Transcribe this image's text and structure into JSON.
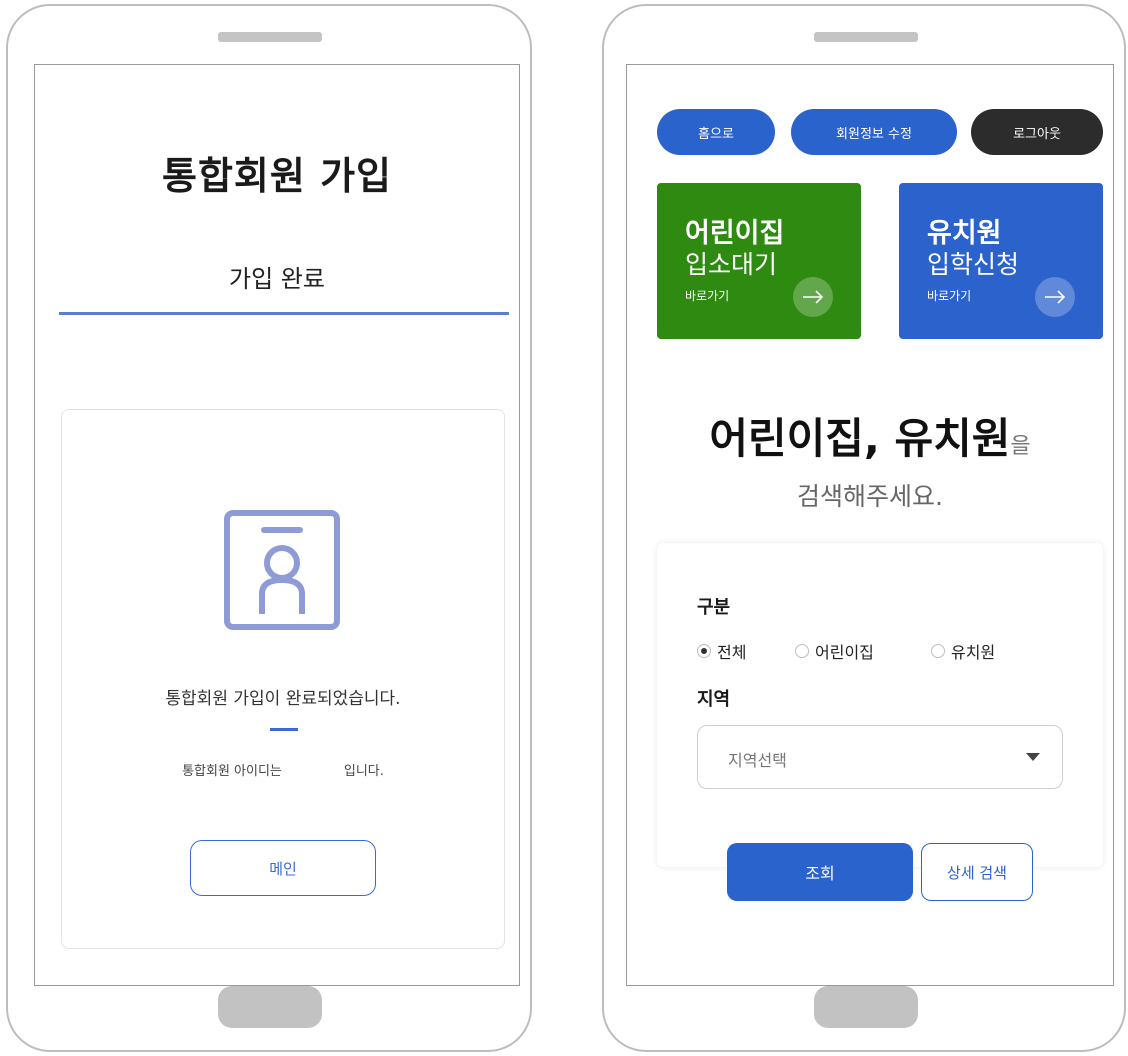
{
  "left_screen": {
    "title": "통합회원 가입",
    "step_label": "가입 완료",
    "card": {
      "icon": "id-card-icon",
      "message": "통합회원 가입이 완료되었습니다.",
      "id_prefix": "통합회원 아이디는",
      "id_value": "",
      "id_suffix": "입니다.",
      "main_button": "메인"
    }
  },
  "right_screen": {
    "top_buttons": {
      "home": "홈으로",
      "edit_profile": "회원정보 수정",
      "logout": "로그아웃"
    },
    "tiles": [
      {
        "line1": "어린이집",
        "line2": "입소대기",
        "link": "바로가기",
        "icon": "arrow-right-icon",
        "color": "#2e8a10"
      },
      {
        "line1": "유치원",
        "line2": "입학신청",
        "link": "바로가기",
        "icon": "arrow-right-icon",
        "color": "#2b62cc"
      }
    ],
    "headline": "어린이집, 유치원",
    "headline_suffix": "을",
    "subline": "검색해주세요.",
    "search_form": {
      "type_label": "구분",
      "options": [
        "전체",
        "어린이집",
        "유치원"
      ],
      "selected_option": "전체",
      "region_label": "지역",
      "region_placeholder": "지역선택",
      "search_button": "조회",
      "detail_button": "상세 검색"
    }
  },
  "colors": {
    "primary_blue": "#2a63cc",
    "green": "#2e8a10",
    "dark": "#2c2c2c",
    "icon_lavender": "#8f9bd6"
  }
}
